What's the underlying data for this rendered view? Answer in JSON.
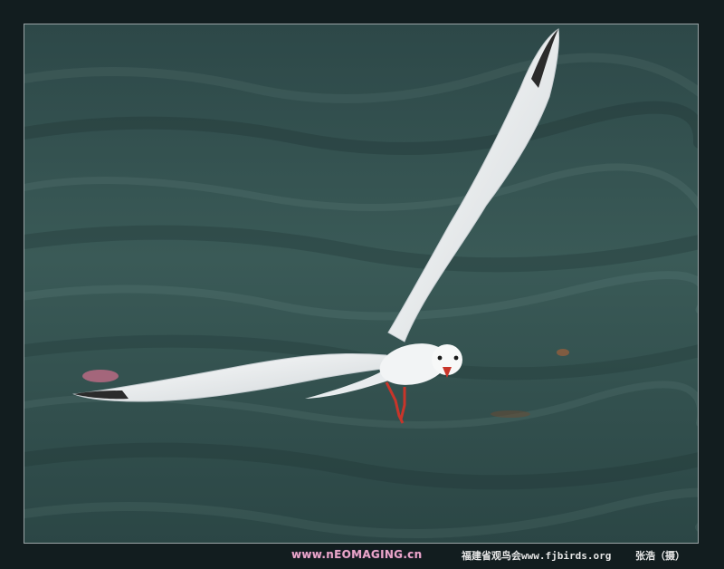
{
  "photo": {
    "subject": "seagull-in-flight-over-water",
    "colors": {
      "border": "#121d1f",
      "water_dark": "#223a3a",
      "water_mid": "#3c5a58",
      "water_light": "#5f7c78",
      "bird_white": "#f4f5f5",
      "bird_shadow": "#b9c0c4",
      "beak_legs": "#c8352a"
    }
  },
  "footer": {
    "watermark": "www.nEOMAGING.cn",
    "credit": "福建省观鸟会www.fjbirds.org",
    "author": "张浩（摄）"
  }
}
